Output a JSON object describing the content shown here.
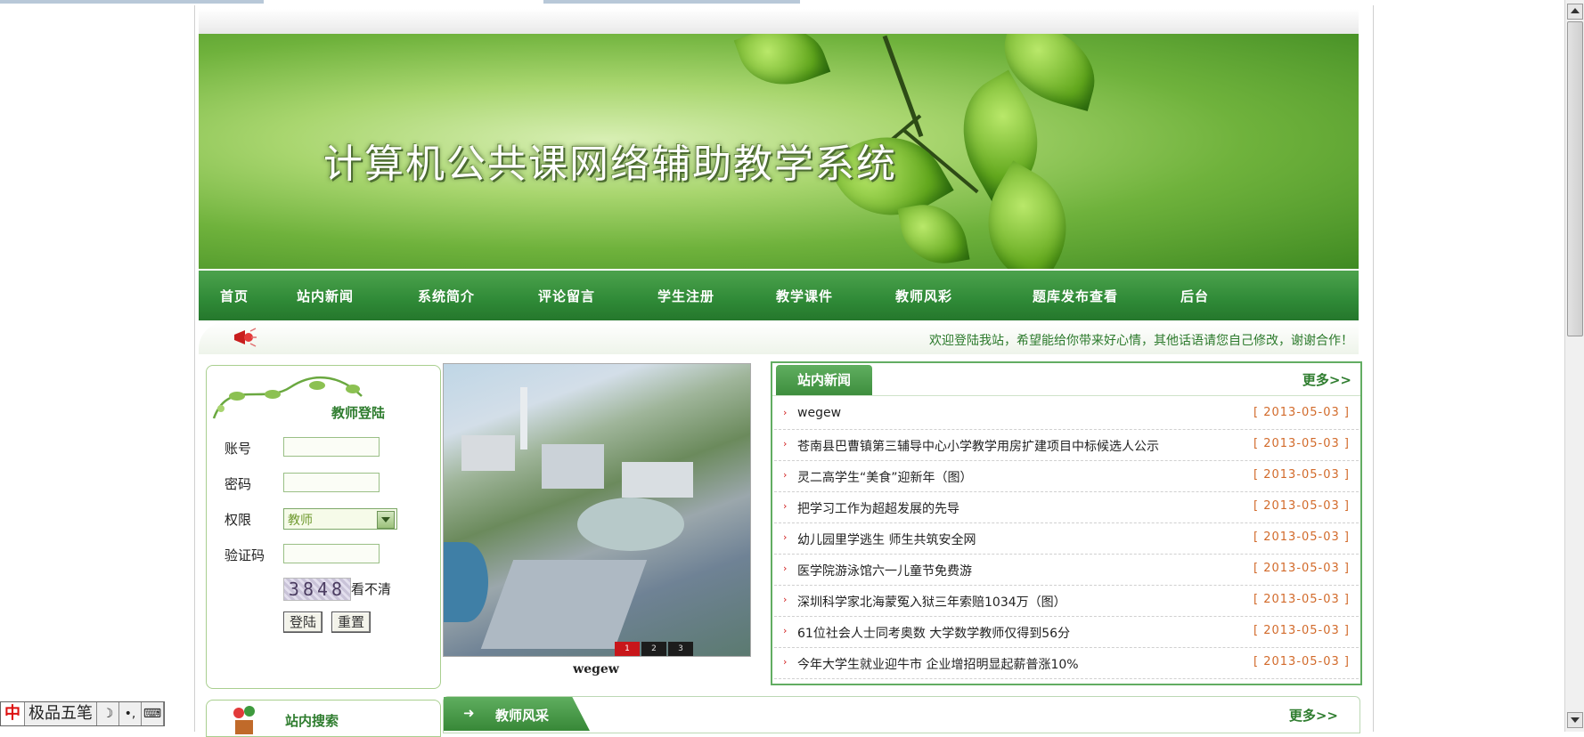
{
  "banner": {
    "title": "计算机公共课网络辅助教学系统"
  },
  "nav": {
    "items": [
      "首页",
      "站内新闻",
      "系统简介",
      "评论留言",
      "学生注册",
      "教学课件",
      "教师风彩",
      "题库发布查看",
      "后台"
    ]
  },
  "ticker": {
    "message": "欢迎登陆我站，希望能给你带来好心情，其他话语请您自己修改，谢谢合作！"
  },
  "login": {
    "title": "教师登陆",
    "account_label": "账号",
    "password_label": "密码",
    "role_label": "权限",
    "role_value": "教师",
    "captcha_label": "验证码",
    "captcha_code": "3848",
    "captcha_hint": "看不清",
    "login_button": "登陆",
    "reset_button": "重置"
  },
  "search": {
    "title": "站内搜索"
  },
  "slideshow": {
    "caption": "wegew",
    "pages": [
      "1",
      "2",
      "3"
    ],
    "active": 0
  },
  "news": {
    "title": "站内新闻",
    "more": "更多>>",
    "items": [
      {
        "title": "wegew",
        "date": "[ 2013-05-03 ]"
      },
      {
        "title": "苍南县巴曹镇第三辅导中心小学教学用房扩建项目中标候选人公示",
        "date": "[ 2013-05-03 ]"
      },
      {
        "title": "灵二高学生“美食”迎新年（图）",
        "date": "[ 2013-05-03 ]"
      },
      {
        "title": "把学习工作为超超发展的先导",
        "date": "[ 2013-05-03 ]"
      },
      {
        "title": "幼儿园里学逃生 师生共筑安全网",
        "date": "[ 2013-05-03 ]"
      },
      {
        "title": "医学院游泳馆六一儿童节免费游",
        "date": "[ 2013-05-03 ]"
      },
      {
        "title": "深圳科学家北海蒙冤入狱三年索赔1034万（图）",
        "date": "[ 2013-05-03 ]"
      },
      {
        "title": "61位社会人士同考奥数 大学数学教师仅得到56分",
        "date": "[ 2013-05-03 ]"
      },
      {
        "title": "今年大学生就业迎牛市 企业增招明显起薪普涨10%",
        "date": "[ 2013-05-03 ]"
      }
    ]
  },
  "teacher": {
    "title": "教师风采",
    "more": "更多>>"
  },
  "ime": {
    "brand": "中",
    "name": "极品五笔",
    "icons": [
      "moon-icon",
      "punctuation-icon",
      "keyboard-icon"
    ]
  }
}
